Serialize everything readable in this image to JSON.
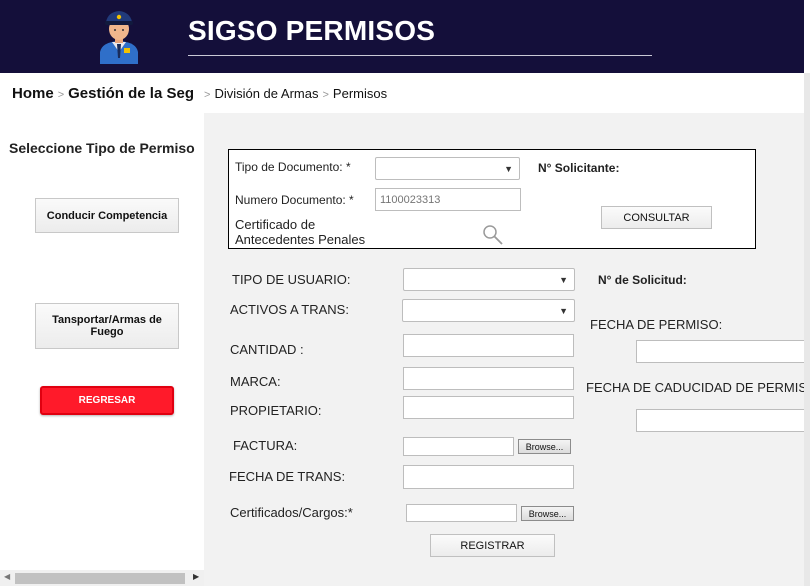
{
  "header": {
    "title": "SIGSO PERMISOS",
    "background_color": "#140f3a",
    "logo_icon": "police-officer-icon"
  },
  "breadcrumb": {
    "home": "Home",
    "gestion": "Gestión de la Seg",
    "division": "División de Armas",
    "permisos": "Permisos",
    "separator": ">"
  },
  "left_panel": {
    "title": "Seleccione Tipo de Permiso",
    "btn_conducir": "Conducir Competencia",
    "btn_transportar": "Tansportar/Armas de Fuego",
    "btn_regresar": "REGRESAR",
    "regresar_color": "#ff1a2a"
  },
  "query": {
    "tipo_documento_label": "Tipo de Documento: *",
    "tipo_documento_value": "",
    "solicitante_label": "N° Solicitante:",
    "numero_documento_label": "Numero Documento: *",
    "numero_documento_placeholder": "1100023313",
    "certificado_label_line1": "Certificado de",
    "certificado_label_line2": "Antecedentes Penales",
    "search_icon": "search-icon",
    "consultar_label": "CONSULTAR"
  },
  "form": {
    "tipo_usuario_label": "TIPO DE  USUARIO:",
    "tipo_usuario_value": "",
    "activos_label": "ACTIVOS A TRANS:",
    "activos_value": "",
    "cantidad_label": "CANTIDAD :",
    "marca_label": "MARCA:",
    "propietario_label": "PROPIETARIO:",
    "factura_label": "FACTURA:",
    "fecha_trans_label": "FECHA DE TRANS:",
    "certificados_label": "Certificados/Cargos:*",
    "browse_label": "Browse...",
    "registrar_label": "REGISTRAR",
    "num_solicitud_label": "N° de Solicitud:",
    "fecha_permiso_label": "FECHA DE PERMISO:",
    "fecha_caducidad_label": "FECHA DE CADUCIDAD DE PERMISO:"
  }
}
